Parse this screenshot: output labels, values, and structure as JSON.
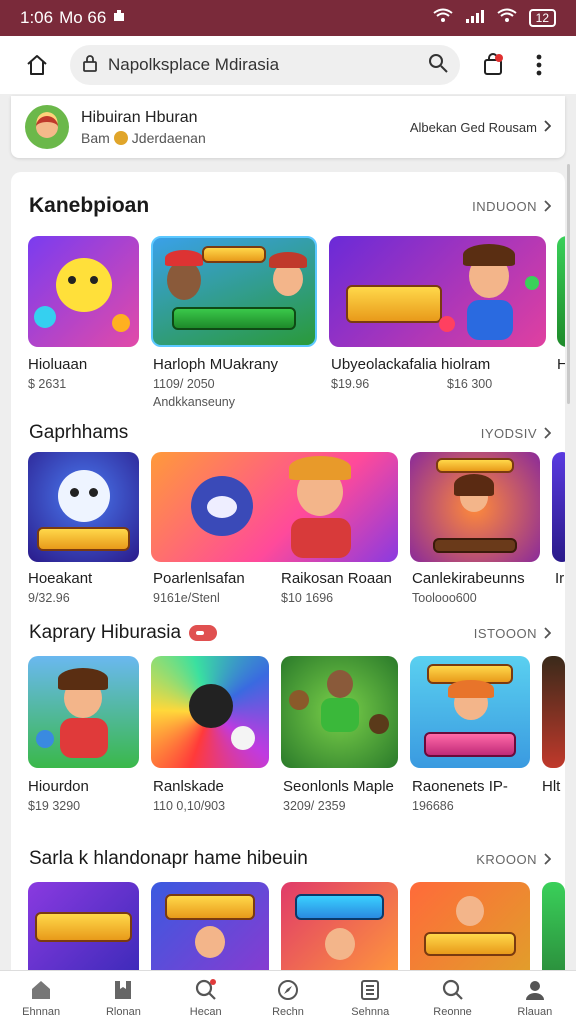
{
  "status_bar": {
    "time": "1:06",
    "carrier_text": "Mo 66",
    "battery": "12"
  },
  "search": {
    "value": "Napolksplace Mdirasia"
  },
  "profile": {
    "name": "Hibuiran Hburan",
    "balance_label": "Bam",
    "status": "Jderdaenan",
    "link": "Albekan Ged Rousam"
  },
  "sections": [
    {
      "title": "Kanebpioan",
      "more": "INDUOON",
      "items": [
        {
          "name": "Hioluaan",
          "meta": "$ 2631"
        },
        {
          "name": "Harloph MUakrany",
          "meta": "1109/ 2050",
          "meta2": "Andkkanseuny"
        },
        {
          "name": "Ubyeolackafalia hiolram",
          "meta": "$19.96",
          "meta_right": "$16 300"
        },
        {
          "name": "H",
          "meta": ""
        }
      ]
    },
    {
      "title": "Gaprhhams",
      "more": "IYODSIV",
      "items": [
        {
          "name": "Hoeakant",
          "meta": "9/32.96"
        },
        {
          "name": "Poarlenlsafan",
          "meta": "9161e/Stenl"
        },
        {
          "name": "Raikosan Roaan",
          "meta": "$10 1696"
        },
        {
          "name": "Canlekirabeunns",
          "meta": "Toolooo600"
        },
        {
          "name": "Ir",
          "meta": ""
        }
      ]
    },
    {
      "title": "Kaprary Hiburasia",
      "more": "ISTOOON",
      "items": [
        {
          "name": "Hiourdon",
          "meta": "$19 3290"
        },
        {
          "name": "Ranlskade",
          "meta": "110 0,10/903"
        },
        {
          "name": "Seonlonls Maple",
          "meta": "3209/ 2359"
        },
        {
          "name": "Raonenets IP-",
          "meta": "196686"
        },
        {
          "name": "Hlt",
          "meta": ""
        }
      ]
    },
    {
      "title": "Sarla k hlandonapr hame hibeuin",
      "more": "KROOON"
    }
  ],
  "bottom_nav": [
    "Ehnnan",
    "Rlonan",
    "Hecan",
    "Rechn",
    "Sehnna",
    "Reonne",
    "Rlauan"
  ],
  "colors": {
    "status_bar": "#7a2a3a",
    "accent": "#e05050"
  }
}
